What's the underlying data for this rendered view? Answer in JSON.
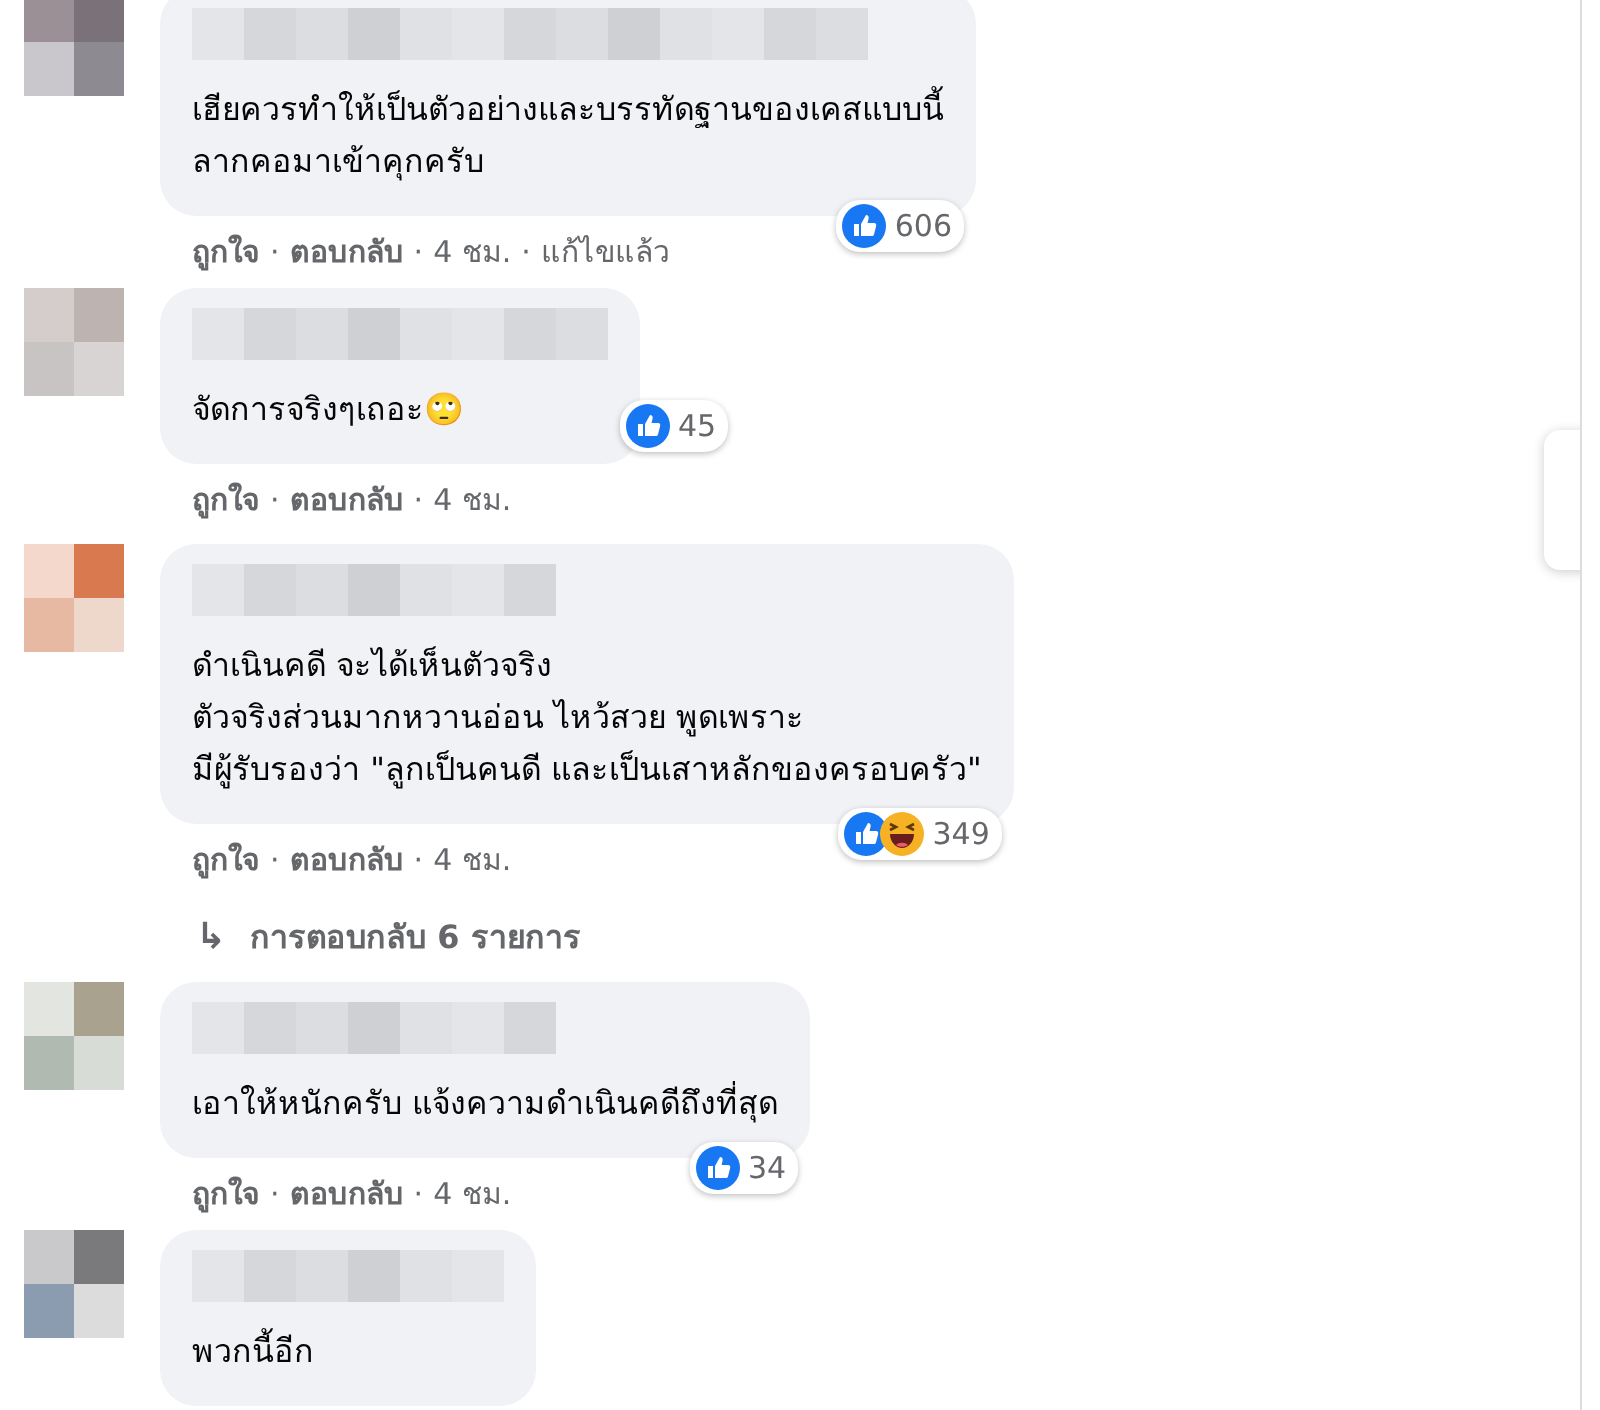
{
  "comments": [
    {
      "lines": [
        "เฮียควรทำให้เป็นตัวอย่างและบรรทัดฐานของเคสแบบนี้",
        "ลากคอมาเข้าคุกครับ"
      ],
      "reactions": [
        {
          "kind": "like"
        }
      ],
      "count": "606",
      "meta": [
        {
          "kind": "link",
          "text": "ถูกใจ"
        },
        {
          "kind": "dot",
          "text": "·"
        },
        {
          "kind": "link",
          "text": "ตอบกลับ"
        },
        {
          "kind": "dot",
          "text": "·"
        },
        {
          "kind": "time",
          "text": "4 ชม."
        },
        {
          "kind": "dot",
          "text": "·"
        },
        {
          "kind": "time",
          "text": "แก้ไขแล้ว"
        }
      ]
    },
    {
      "lines": [
        "จัดการจริงๆเถอะ🙄"
      ],
      "reactions": [
        {
          "kind": "like"
        }
      ],
      "count": "45",
      "meta": [
        {
          "kind": "link",
          "text": "ถูกใจ"
        },
        {
          "kind": "dot",
          "text": "·"
        },
        {
          "kind": "link",
          "text": "ตอบกลับ"
        },
        {
          "kind": "dot",
          "text": "·"
        },
        {
          "kind": "time",
          "text": "4 ชม."
        }
      ]
    },
    {
      "lines": [
        "ดำเนินคดี จะได้เห็นตัวจริง",
        "ตัวจริงส่วนมากหวานอ่อน ไหว้สวย พูดเพราะ",
        "มีผู้รับรองว่า \"ลูกเป็นคนดี และเป็นเสาหลักของครอบครัว\""
      ],
      "reactions": [
        {
          "kind": "like"
        },
        {
          "kind": "haha"
        }
      ],
      "count": "349",
      "meta": [
        {
          "kind": "link",
          "text": "ถูกใจ"
        },
        {
          "kind": "dot",
          "text": "·"
        },
        {
          "kind": "link",
          "text": "ตอบกลับ"
        },
        {
          "kind": "dot",
          "text": "·"
        },
        {
          "kind": "time",
          "text": "4 ชม."
        }
      ],
      "replies": {
        "arrow": "↳",
        "text": "การตอบกลับ 6 รายการ"
      }
    },
    {
      "lines": [
        "เอาให้หนักครับ แจ้งความดำเนินคดีถึงที่สุด"
      ],
      "reactions": [
        {
          "kind": "like"
        }
      ],
      "count": "34",
      "meta": [
        {
          "kind": "link",
          "text": "ถูกใจ"
        },
        {
          "kind": "dot",
          "text": "·"
        },
        {
          "kind": "link",
          "text": "ตอบกลับ"
        },
        {
          "kind": "dot",
          "text": "·"
        },
        {
          "kind": "time",
          "text": "4 ชม."
        }
      ]
    },
    {
      "lines": [
        "พวกนี้อีก"
      ]
    }
  ]
}
